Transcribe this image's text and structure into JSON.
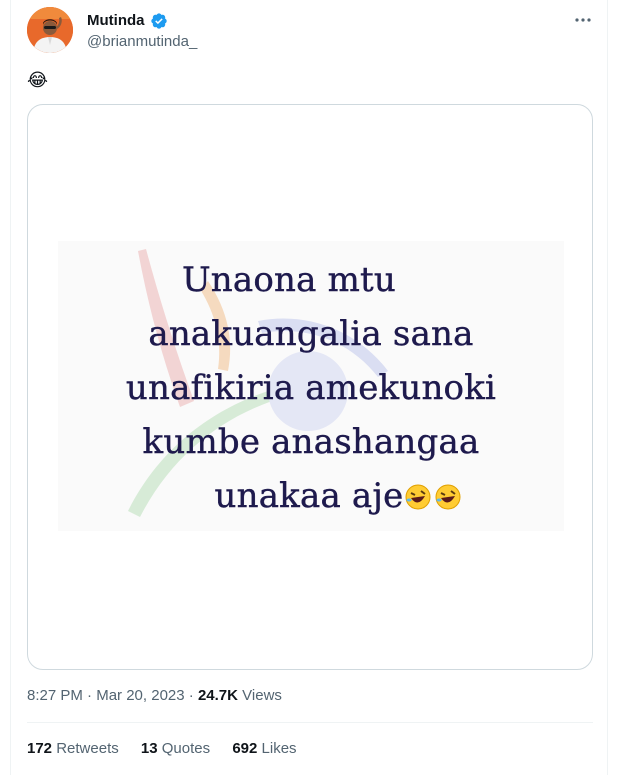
{
  "author": {
    "display_name": "Mutinda",
    "handle": "@brianmutinda_",
    "verified": true,
    "verified_color": "#1d9bf0",
    "avatar_bg": "#e8692b"
  },
  "tweet": {
    "text_emoji": "😂",
    "more_icon": "more-horizontal-icon"
  },
  "media": {
    "lines": [
      "Unaona mtu",
      "anakuangalia sana",
      "unafikiria amekunoki",
      "kumbe anashangaa",
      "unakaa aje"
    ],
    "trailing_emoji": "🤣🤣",
    "text_color": "#1e1a4d"
  },
  "meta": {
    "time": "8:27 PM",
    "separator": "·",
    "date": "Mar 20, 2023",
    "views_count": "24.7K",
    "views_label": "Views"
  },
  "stats": {
    "retweets_count": "172",
    "retweets_label": "Retweets",
    "quotes_count": "13",
    "quotes_label": "Quotes",
    "likes_count": "692",
    "likes_label": "Likes"
  }
}
